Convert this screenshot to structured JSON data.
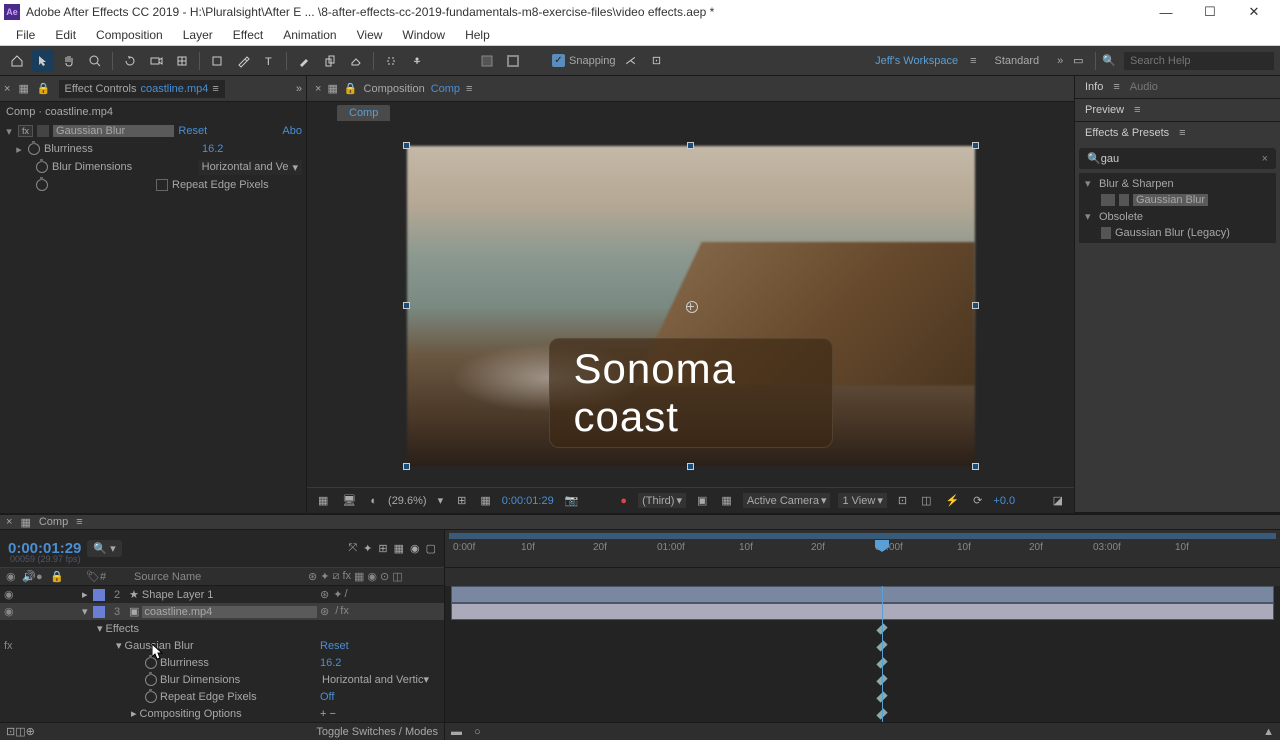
{
  "titlebar": {
    "icon_text": "Ae",
    "title": "Adobe After Effects CC 2019 - H:\\Pluralsight\\After E ... \\8-after-effects-cc-2019-fundamentals-m8-exercise-files\\video effects.aep *"
  },
  "menubar": [
    "File",
    "Edit",
    "Composition",
    "Layer",
    "Effect",
    "Animation",
    "View",
    "Window",
    "Help"
  ],
  "toolbar": {
    "snapping": "Snapping",
    "workspace": "Jeff's Workspace",
    "standard": "Standard",
    "search_placeholder": "Search Help"
  },
  "effect_controls": {
    "tab_prefix": "Effect Controls",
    "tab_file": "coastline.mp4",
    "header": "Comp · coastline.mp4",
    "effect_name": "Gaussian Blur",
    "reset": "Reset",
    "abo": "Abo",
    "blurriness_label": "Blurriness",
    "blurriness_value": "16.2",
    "blur_dim_label": "Blur Dimensions",
    "blur_dim_value": "Horizontal and Ve",
    "repeat_label": "Repeat Edge Pixels"
  },
  "composition": {
    "tab_prefix": "Composition",
    "tab_name": "Comp",
    "subtab": "Comp",
    "overlay_text": "Sonoma coast",
    "controls": {
      "zoom": "(29.6%)",
      "time": "0:00:01:29",
      "res": "(Third)",
      "camera": "Active Camera",
      "views": "1 View",
      "exposure": "+0.0"
    }
  },
  "right": {
    "info": "Info",
    "audio": "Audio",
    "preview": "Preview",
    "effects_presets": "Effects & Presets",
    "search_value": "gau",
    "cat1": "Blur & Sharpen",
    "item1": "Gaussian Blur",
    "cat2": "Obsolete",
    "item2": "Gaussian Blur (Legacy)"
  },
  "timeline": {
    "tab": "Comp",
    "current_time": "0:00:01:29",
    "fps": "00059 (29.97 fps)",
    "col_num": "#",
    "col_source": "Source Name",
    "layers": [
      {
        "num": "2",
        "name": "Shape Layer 1",
        "color": "#6a7fd4"
      },
      {
        "num": "3",
        "name": "coastline.mp4",
        "color": "#6a7fd4"
      }
    ],
    "effects_label": "Effects",
    "gb_label": "Gaussian Blur",
    "gb_reset": "Reset",
    "gb_blurriness": "Blurriness",
    "gb_blurriness_val": "16.2",
    "gb_dim": "Blur Dimensions",
    "gb_dim_val": "Horizontal and Vertic",
    "gb_repeat": "Repeat Edge Pixels",
    "gb_repeat_val": "Off",
    "comp_opts": "Compositing Options",
    "ruler": [
      "0:00f",
      "10f",
      "20f",
      "01:00f",
      "10f",
      "20f",
      "02:00f",
      "10f",
      "20f",
      "03:00f",
      "10f"
    ],
    "toggle": "Toggle Switches / Modes"
  }
}
